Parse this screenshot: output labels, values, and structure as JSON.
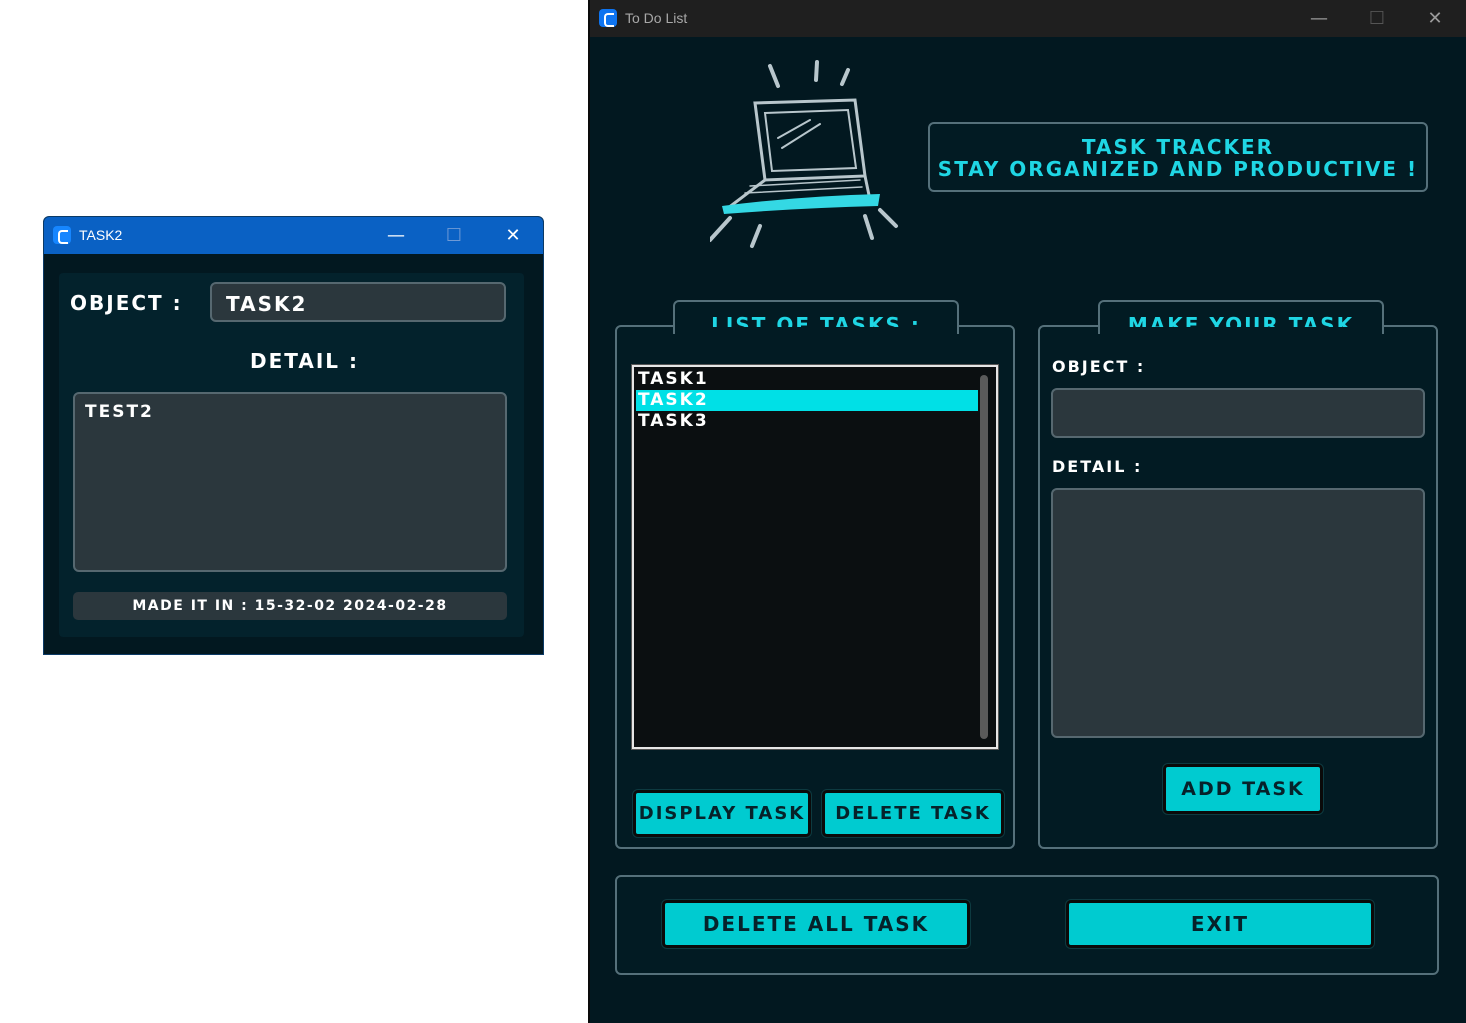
{
  "main_window": {
    "title": "To Do List",
    "header_line1": "TASK TRACKER",
    "header_line2": "STAY ORGANIZED AND PRODUCTIVE !",
    "list_panel_title": "LIST OF TASKS :",
    "tasks": [
      {
        "label": "TASK1",
        "selected": false
      },
      {
        "label": "TASK2",
        "selected": true
      },
      {
        "label": "TASK3",
        "selected": false
      }
    ],
    "display_button": "DISPLAY TASK",
    "delete_button": "DELETE TASK",
    "make_panel_title": "MAKE YOUR TASK",
    "object_label": "OBJECT :",
    "object_value": "",
    "detail_label": "DETAIL :",
    "detail_value": "",
    "add_button": "ADD TASK",
    "delete_all_button": "DELETE ALL TASK",
    "exit_button": "EXIT"
  },
  "task_window": {
    "title": "TASK2",
    "object_label": "OBJECT :",
    "object_value": "TASK2",
    "detail_label": "DETAIL  :",
    "detail_value": "TEST2",
    "made_in": "MADE IT IN : 15-32-02 2024-02-28"
  },
  "window_controls": {
    "minimize": "—",
    "maximize": "☐",
    "close": "✕"
  },
  "colors": {
    "accent": "#00cbd0",
    "background": "#021820",
    "title_text": "#1fd6e4"
  }
}
